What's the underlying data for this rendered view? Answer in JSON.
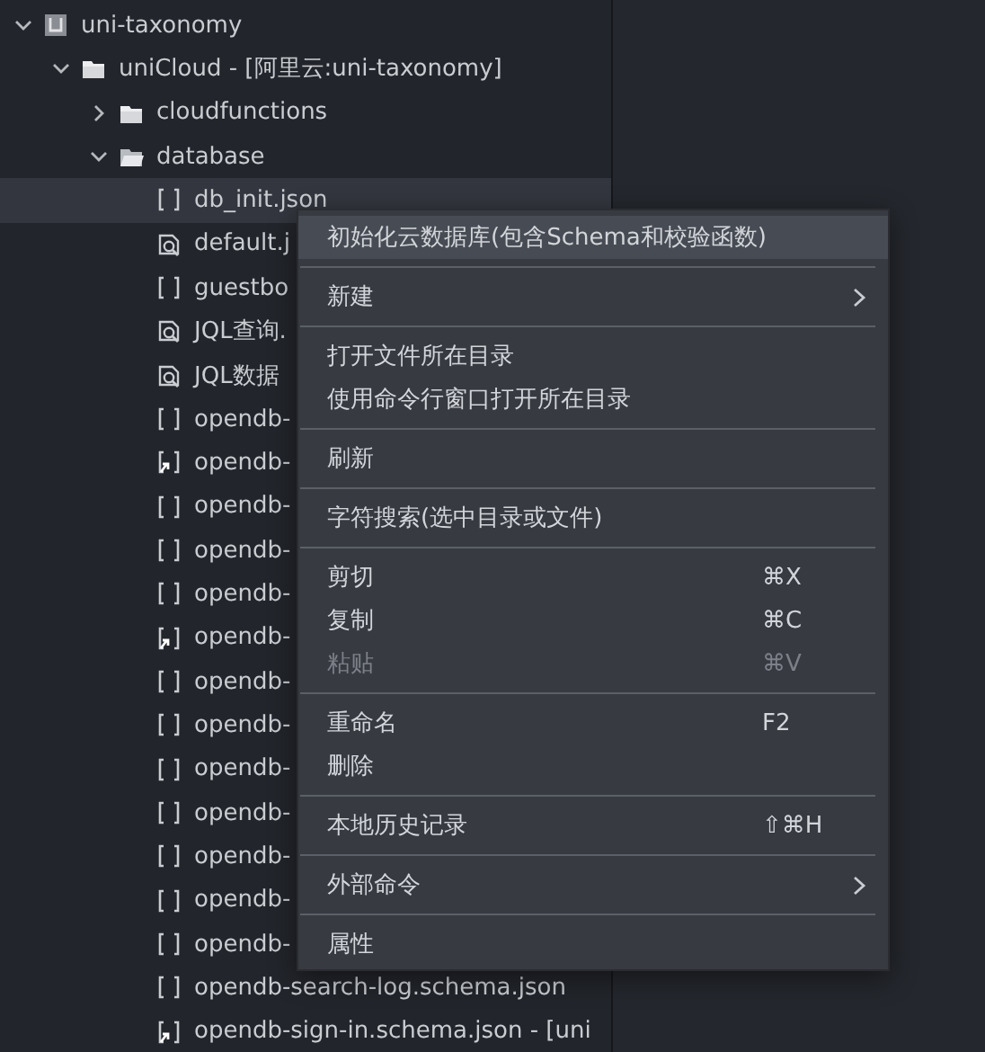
{
  "tree": [
    {
      "label": "uni-taxonomy",
      "kind": "project",
      "expanded": true,
      "selected": false,
      "children": [
        {
          "label": "uniCloud - [阿里云:uni-taxonomy]",
          "kind": "cloud-folder",
          "expanded": true,
          "selected": false,
          "children": [
            {
              "label": "cloudfunctions",
              "kind": "cloud-folder",
              "expanded": false,
              "selected": false
            },
            {
              "label": "database",
              "kind": "folder",
              "expanded": true,
              "selected": false,
              "children": [
                {
                  "label": "db_init.json",
                  "kind": "json",
                  "selected": true
                },
                {
                  "label": "default.j",
                  "kind": "query",
                  "selected": false
                },
                {
                  "label": "guestbo",
                  "kind": "json",
                  "selected": false
                },
                {
                  "label": "JQL查询.",
                  "kind": "query",
                  "selected": false
                },
                {
                  "label": "JQL数据",
                  "kind": "query",
                  "selected": false
                },
                {
                  "label": "opendb-",
                  "kind": "json",
                  "selected": false
                },
                {
                  "label": "opendb-",
                  "kind": "linked",
                  "selected": false
                },
                {
                  "label": "opendb-",
                  "kind": "json",
                  "selected": false
                },
                {
                  "label": "opendb-",
                  "kind": "json",
                  "selected": false
                },
                {
                  "label": "opendb-",
                  "kind": "json",
                  "selected": false
                },
                {
                  "label": "opendb-",
                  "kind": "linked",
                  "selected": false
                },
                {
                  "label": "opendb-",
                  "kind": "json",
                  "selected": false
                },
                {
                  "label": "opendb-",
                  "kind": "json",
                  "selected": false
                },
                {
                  "label": "opendb-",
                  "kind": "json",
                  "selected": false
                },
                {
                  "label": "opendb-",
                  "kind": "json",
                  "selected": false
                },
                {
                  "label": "opendb-",
                  "kind": "json",
                  "selected": false
                },
                {
                  "label": "opendb-",
                  "kind": "json",
                  "selected": false
                },
                {
                  "label": "opendb-",
                  "kind": "json",
                  "selected": false
                },
                {
                  "label": "opendb-search-log.schema.json",
                  "kind": "json",
                  "selected": false
                },
                {
                  "label": "opendb-sign-in.schema.json - [uni",
                  "kind": "linked",
                  "selected": false
                }
              ]
            }
          ]
        }
      ]
    }
  ],
  "context_menu": [
    {
      "kind": "item",
      "label": "初始化云数据库(包含Schema和校验函数)",
      "selected": true,
      "disabled": false
    },
    {
      "kind": "separator"
    },
    {
      "kind": "item",
      "label": "新建",
      "submenu": true,
      "selected": false,
      "disabled": false
    },
    {
      "kind": "separator"
    },
    {
      "kind": "item",
      "label": "打开文件所在目录",
      "selected": false,
      "disabled": false
    },
    {
      "kind": "item",
      "label": "使用命令行窗口打开所在目录",
      "selected": false,
      "disabled": false
    },
    {
      "kind": "separator"
    },
    {
      "kind": "item",
      "label": "刷新",
      "selected": false,
      "disabled": false
    },
    {
      "kind": "separator"
    },
    {
      "kind": "item",
      "label": "字符搜索(选中目录或文件)",
      "selected": false,
      "disabled": false
    },
    {
      "kind": "separator"
    },
    {
      "kind": "item",
      "label": "剪切",
      "shortcut": "⌘X",
      "selected": false,
      "disabled": false
    },
    {
      "kind": "item",
      "label": "复制",
      "shortcut": "⌘C",
      "selected": false,
      "disabled": false
    },
    {
      "kind": "item",
      "label": "粘贴",
      "shortcut": "⌘V",
      "selected": false,
      "disabled": true
    },
    {
      "kind": "separator"
    },
    {
      "kind": "item",
      "label": "重命名",
      "shortcut": "F2",
      "selected": false,
      "disabled": false
    },
    {
      "kind": "item",
      "label": "删除",
      "selected": false,
      "disabled": false
    },
    {
      "kind": "separator"
    },
    {
      "kind": "item",
      "label": "本地历史记录",
      "shortcut": "⇧⌘H",
      "selected": false,
      "disabled": false
    },
    {
      "kind": "separator"
    },
    {
      "kind": "item",
      "label": "外部命令",
      "submenu": true,
      "selected": false,
      "disabled": false
    },
    {
      "kind": "separator"
    },
    {
      "kind": "item",
      "label": "属性",
      "selected": false,
      "disabled": false
    }
  ]
}
